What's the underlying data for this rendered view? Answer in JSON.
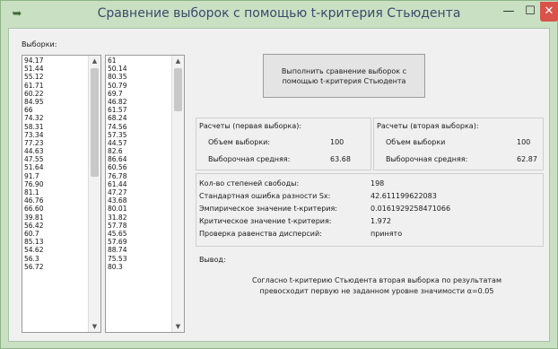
{
  "window": {
    "title": "Сравнение выборок с помощью t-критерия Стьюдента",
    "minimize_glyph": "—",
    "maximize_glyph": "☐",
    "close_glyph": "✕",
    "app_icon": "arrow-icon"
  },
  "samples": {
    "label": "Выборки:",
    "list1": [
      "94.17",
      "51.44",
      "55.12",
      "61.71",
      "60.22",
      "84.95",
      "66",
      "74.32",
      "58.31",
      "73.34",
      "77.23",
      "44.63",
      "47.55",
      "51.64",
      "91.7",
      "76.90",
      "81.1",
      "46.76",
      "66.60",
      "39.81",
      "56.42",
      "60.7",
      "85.13",
      "54.62",
      "56.3",
      "56.72"
    ],
    "list2": [
      "61",
      "50.14",
      "80.35",
      "50.79",
      "69.7",
      "46.82",
      "61.57",
      "68.24",
      "74.56",
      "57.35",
      "44.57",
      "82.6",
      "86.64",
      "60.56",
      "76.78",
      "61.44",
      "47.27",
      "43.68",
      "80.01",
      "31.82",
      "57.78",
      "45.65",
      "57.69",
      "88.74",
      "75.53",
      "80.3"
    ]
  },
  "run_button": {
    "label": "Выполнить сравнение выборок с помощью t-критерия Стьюдента"
  },
  "calc1": {
    "header": "Расчеты (первая выборка):",
    "size_label": "Объем выборки:",
    "size_value": "100",
    "mean_label": "Выборочная средняя:",
    "mean_value": "63.68"
  },
  "calc2": {
    "header": "Расчеты (вторая выборка):",
    "size_label": "Объем выборки",
    "size_value": "100",
    "mean_label": "Выборочная средняя:",
    "mean_value": "62.87"
  },
  "stats": {
    "df_label": "Кол-во степеней свободы:",
    "df_value": "198",
    "se_label": "Стандартная ошибка разности Sx:",
    "se_value": "42.611199622083",
    "temp_label": "Эмпирическое значение t-критерия:",
    "temp_value": "0.0161929258471066",
    "tcrit_label": "Критическое значение t-критерия:",
    "tcrit_value": "1.972",
    "var_label": "Проверка равенства дисперсий:",
    "var_value": "принято"
  },
  "conclusion": {
    "label": "Вывод:",
    "text": "Согласно t-критерию Стьюдента вторая выборка по результатам превосходит первую не заданном уровне значимости α=0.05"
  }
}
